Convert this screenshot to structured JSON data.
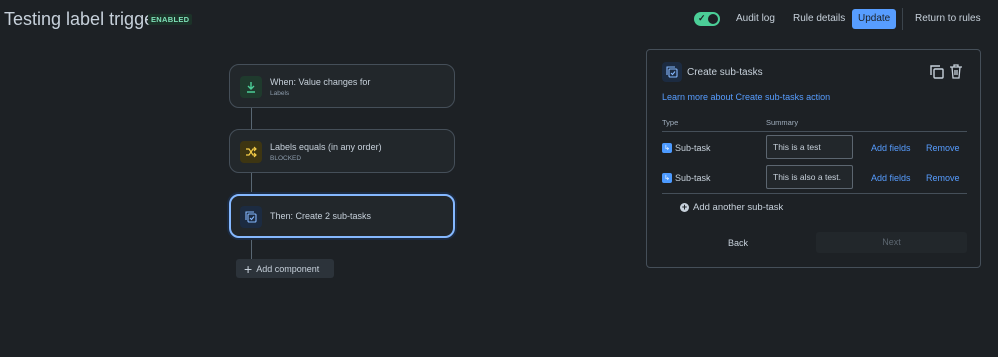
{
  "header": {
    "title": "Testing label trigger",
    "status_badge": "ENABLED",
    "toggle_checked": true,
    "buttons": {
      "audit_log": "Audit log",
      "rule_details": "Rule details",
      "update": "Update",
      "return_to_rules": "Return to rules"
    }
  },
  "flow": {
    "nodes": [
      {
        "title": "When: Value changes for",
        "subtitle": "Labels",
        "icon": "field-change-icon",
        "color": "#4bce97"
      },
      {
        "title": "Labels equals (in any order)",
        "subtitle": "BLOCKED",
        "icon": "shuffle-icon",
        "color": "#f5cd47"
      },
      {
        "title": "Then: Create 2 sub-tasks",
        "icon": "subtask-icon",
        "color": "#85b8ff"
      }
    ],
    "add_component": "Add component"
  },
  "panel": {
    "title": "Create sub-tasks",
    "learn_more": "Learn more about Create sub-tasks action",
    "columns": {
      "type": "Type",
      "summary": "Summary"
    },
    "rows": [
      {
        "type": "Sub-task",
        "summary": "This is a test",
        "add_fields": "Add fields",
        "remove": "Remove"
      },
      {
        "type": "Sub-task",
        "summary": "This is also a test.",
        "add_fields": "Add fields",
        "remove": "Remove"
      }
    ],
    "add_another": "Add another sub-task",
    "back": "Back",
    "next": "Next"
  },
  "colors": {
    "accent": "#579dff",
    "background": "#1d2125",
    "success": "#4bce97"
  }
}
